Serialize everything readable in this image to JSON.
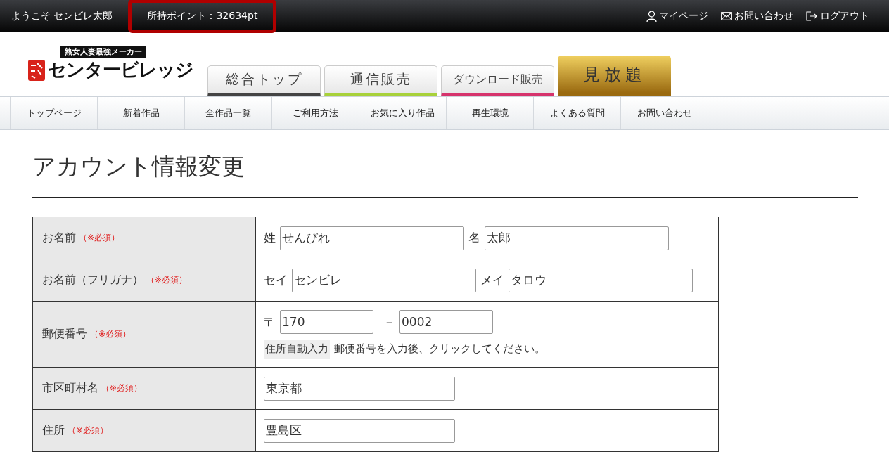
{
  "top_bar": {
    "welcome": "ようこそ センビレ太郎",
    "points": {
      "text": "所持ポイント：32634pt",
      "highlighted": true
    },
    "links": [
      {
        "kind": "person",
        "label": "マイページ"
      },
      {
        "kind": "mail",
        "label": "お問い合わせ"
      },
      {
        "kind": "logout",
        "label": "ログアウト"
      }
    ]
  },
  "logo": {
    "tagline": "熟女人妻最強メーカー",
    "name": "センタービレッジ"
  },
  "category_tabs": [
    {
      "label": "総合トップ",
      "color": "#444444",
      "kind": "plain"
    },
    {
      "label": "通信販売",
      "color": "#a8d13a",
      "kind": "plain"
    },
    {
      "label": "ダウンロード販売",
      "color": "#d6336c",
      "kind": "plain"
    },
    {
      "label": "見放題",
      "color": "#9a6a10",
      "kind": "gold"
    }
  ],
  "nav": [
    "トップページ",
    "新着作品",
    "全作品一覧",
    "ご利用方法",
    "お気に入り作品",
    "再生環境",
    "よくある質問",
    "お問い合わせ"
  ],
  "page_title": "アカウント情報変更",
  "form": [
    {
      "label": "お名前",
      "required": "（※必須）",
      "kind": "pair",
      "fields": [
        {
          "prefix": "姓",
          "value": "せんびれ"
        },
        {
          "prefix": "名",
          "value": "太郎"
        }
      ]
    },
    {
      "label": "お名前（フリガナ）",
      "required": "（※必須）",
      "kind": "pair",
      "fields": [
        {
          "prefix": "セイ",
          "value": "センビレ"
        },
        {
          "prefix": "メイ",
          "value": "タロウ"
        }
      ]
    },
    {
      "label": "郵便番号",
      "required": "（※必須）",
      "kind": "postal",
      "fields": [
        {
          "prefix": "〒",
          "value": "170"
        },
        {
          "prefix": "－",
          "value": "0002"
        }
      ],
      "button": "住所自動入力",
      "note": "郵便番号を入力後、クリックしてください。"
    },
    {
      "label": "市区町村名",
      "required": "（※必須）",
      "kind": "single",
      "fields": [
        {
          "value": "東京都"
        }
      ]
    },
    {
      "label": "住所",
      "required": "（※必須）",
      "kind": "single",
      "fields": [
        {
          "value": "豊島区"
        }
      ]
    }
  ]
}
